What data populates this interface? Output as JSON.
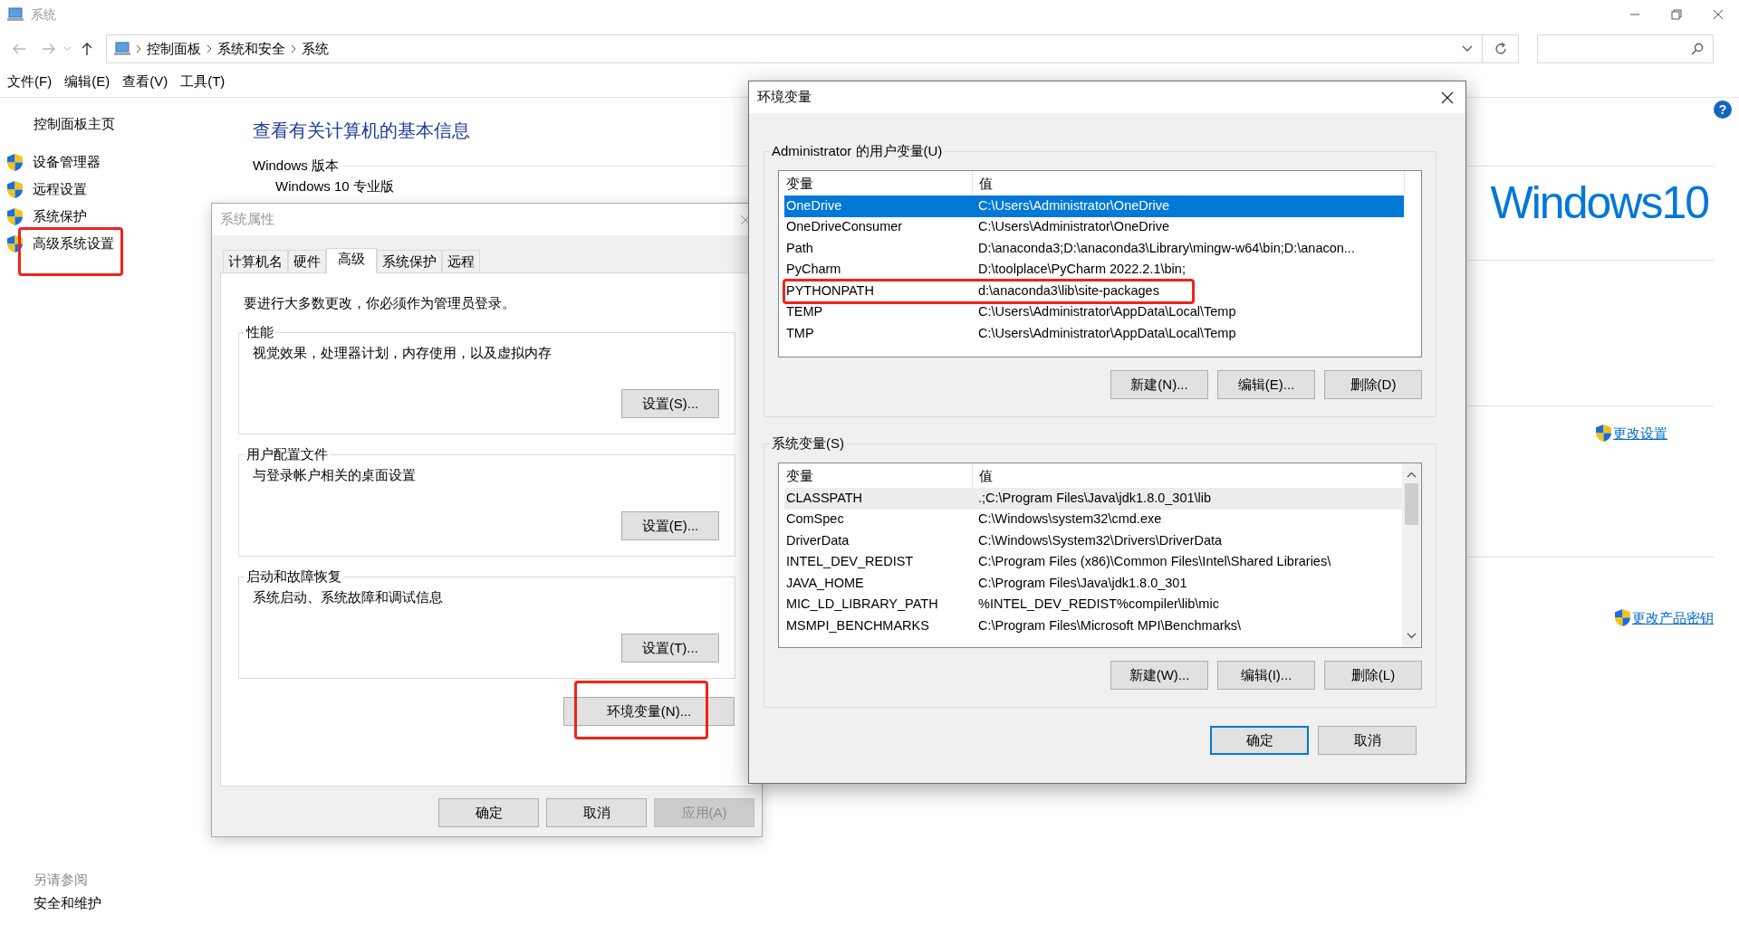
{
  "window": {
    "title": "系统",
    "active": false
  },
  "address_bar": {
    "breadcrumbs": [
      "控制面板",
      "系统和安全",
      "系统"
    ]
  },
  "menu": [
    "文件(F)",
    "编辑(E)",
    "查看(V)",
    "工具(T)"
  ],
  "sidebar": {
    "home": "控制面板主页",
    "items": [
      {
        "label": "设备管理器",
        "annotated": false
      },
      {
        "label": "远程设置",
        "annotated": false
      },
      {
        "label": "系统保护",
        "annotated": false
      },
      {
        "label": "高级系统设置",
        "annotated": true
      }
    ],
    "see_also": {
      "title": "另请参阅",
      "links": [
        "安全和维护"
      ]
    }
  },
  "main": {
    "heading": "查看有关计算机的基本信息",
    "edition_title": "Windows 版本",
    "edition": "Windows 10 专业版",
    "logo": "Windows10",
    "links": [
      "更改设置",
      "更改产品密钥"
    ]
  },
  "help": "?",
  "system_properties": {
    "title": "系统属性",
    "active": false,
    "tabs": [
      {
        "label": "计算机名",
        "selected": false
      },
      {
        "label": "硬件",
        "selected": false
      },
      {
        "label": "高级",
        "selected": true
      },
      {
        "label": "系统保护",
        "selected": false
      },
      {
        "label": "远程",
        "selected": false
      }
    ],
    "notice": "要进行大多数更改，你必须作为管理员登录。",
    "groups": [
      {
        "title": "性能",
        "description": "视觉效果，处理器计划，内存使用，以及虚拟内存",
        "button": "设置(S)..."
      },
      {
        "title": "用户配置文件",
        "description": "与登录帐户相关的桌面设置",
        "button": "设置(E)..."
      },
      {
        "title": "启动和故障恢复",
        "description": "系统启动、系统故障和调试信息",
        "button": "设置(T)..."
      }
    ],
    "env_button": {
      "label": "环境变量(N)...",
      "annotated": true
    },
    "buttons": [
      {
        "label": "确定",
        "disabled": false
      },
      {
        "label": "取消",
        "disabled": false
      },
      {
        "label": "应用(A)",
        "disabled": true
      }
    ]
  },
  "environment_variables": {
    "title": "环境变量",
    "active": true,
    "user_group": {
      "title": "Administrator 的用户变量(U)",
      "columns": [
        "变量",
        "值"
      ],
      "rows": [
        {
          "name": "OneDrive",
          "value": "C:\\Users\\Administrator\\OneDrive",
          "selected": true,
          "hovered": false,
          "annotated": false
        },
        {
          "name": "OneDriveConsumer",
          "value": "C:\\Users\\Administrator\\OneDrive",
          "selected": false,
          "hovered": false,
          "annotated": false
        },
        {
          "name": "Path",
          "value": "D:\\anaconda3;D:\\anaconda3\\Library\\mingw-w64\\bin;D:\\anacon...",
          "selected": false,
          "hovered": false,
          "annotated": false
        },
        {
          "name": "PyCharm",
          "value": "D:\\toolplace\\PyCharm 2022.2.1\\bin;",
          "selected": false,
          "hovered": false,
          "annotated": false
        },
        {
          "name": "PYTHONPATH",
          "value": "d:\\anaconda3\\lib\\site-packages",
          "selected": false,
          "hovered": false,
          "annotated": true
        },
        {
          "name": "TEMP",
          "value": "C:\\Users\\Administrator\\AppData\\Local\\Temp",
          "selected": false,
          "hovered": false,
          "annotated": false
        },
        {
          "name": "TMP",
          "value": "C:\\Users\\Administrator\\AppData\\Local\\Temp",
          "selected": false,
          "hovered": false,
          "annotated": false
        }
      ],
      "buttons": [
        "新建(N)...",
        "编辑(E)...",
        "删除(D)"
      ]
    },
    "system_group": {
      "title": "系统变量(S)",
      "columns": [
        "变量",
        "值"
      ],
      "rows": [
        {
          "name": "CLASSPATH",
          "value": ".;C:\\Program Files\\Java\\jdk1.8.0_301\\lib",
          "selected": false,
          "hovered": true,
          "annotated": false
        },
        {
          "name": "ComSpec",
          "value": "C:\\Windows\\system32\\cmd.exe",
          "selected": false,
          "hovered": false,
          "annotated": false
        },
        {
          "name": "DriverData",
          "value": "C:\\Windows\\System32\\Drivers\\DriverData",
          "selected": false,
          "hovered": false,
          "annotated": false
        },
        {
          "name": "INTEL_DEV_REDIST",
          "value": "C:\\Program Files (x86)\\Common Files\\Intel\\Shared Libraries\\",
          "selected": false,
          "hovered": false,
          "annotated": false
        },
        {
          "name": "JAVA_HOME",
          "value": "C:\\Program Files\\Java\\jdk1.8.0_301",
          "selected": false,
          "hovered": false,
          "annotated": false
        },
        {
          "name": "MIC_LD_LIBRARY_PATH",
          "value": "%INTEL_DEV_REDIST%compiler\\lib\\mic",
          "selected": false,
          "hovered": false,
          "annotated": false
        },
        {
          "name": "MSMPI_BENCHMARKS",
          "value": "C:\\Program Files\\Microsoft MPI\\Benchmarks\\",
          "selected": false,
          "hovered": false,
          "annotated": false
        }
      ],
      "buttons": [
        "新建(W)...",
        "编辑(I)...",
        "删除(L)"
      ]
    },
    "buttons": [
      {
        "label": "确定",
        "default": true
      },
      {
        "label": "取消",
        "default": false
      }
    ]
  }
}
